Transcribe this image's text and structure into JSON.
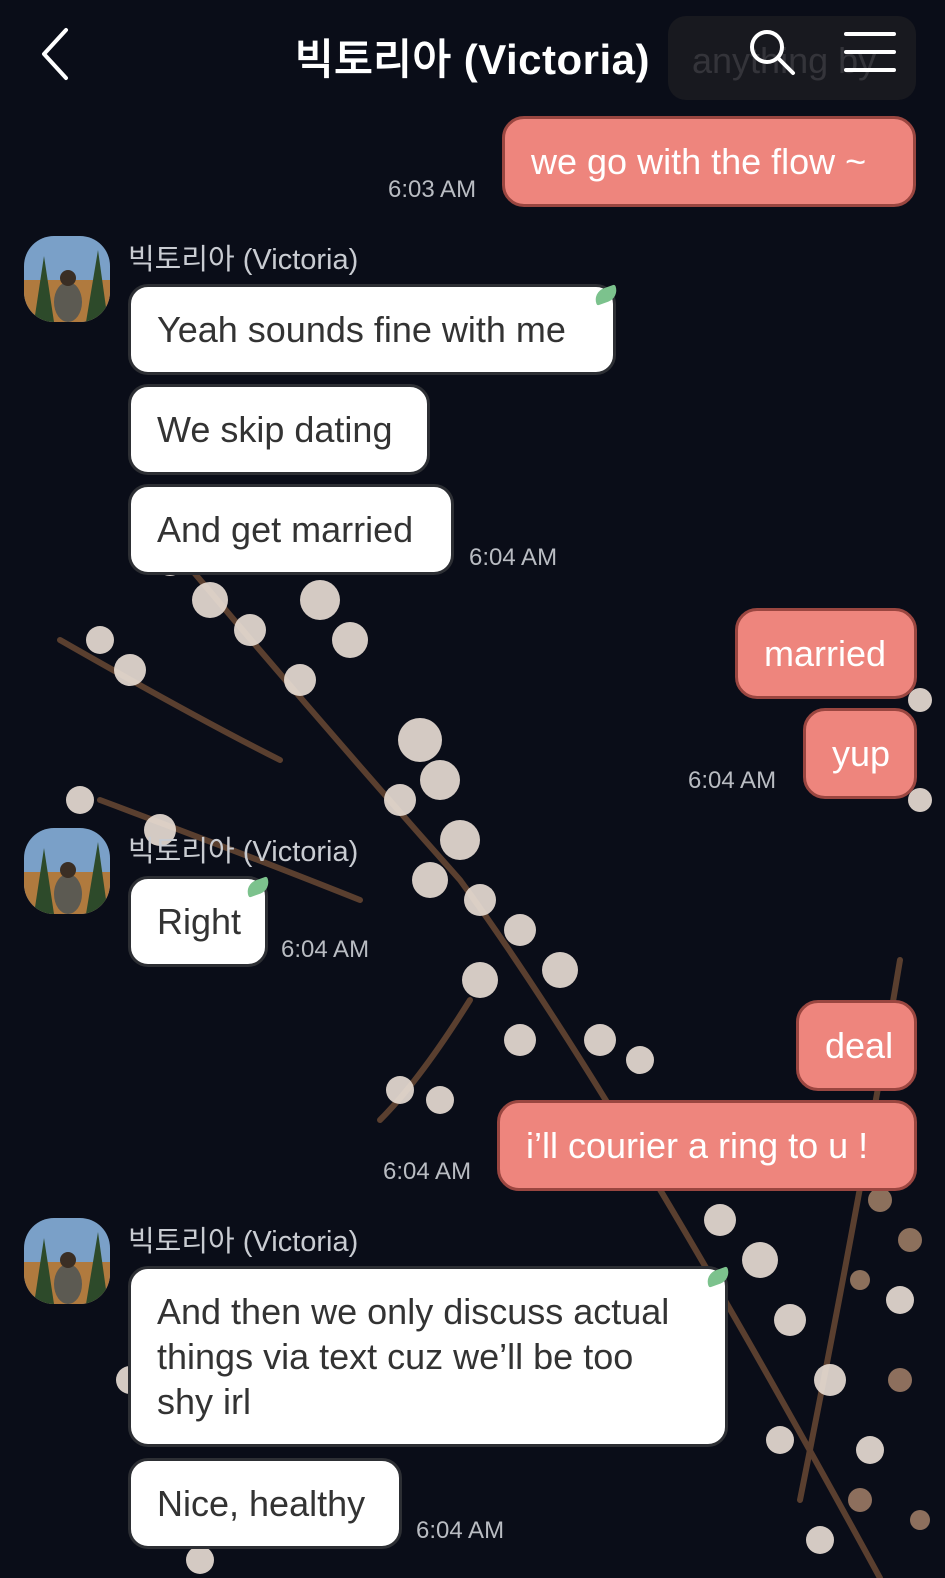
{
  "header": {
    "title": "빅토리아 (Victoria)",
    "search_ghost_text": "anything by"
  },
  "icons": {
    "back": "chevron-left-icon",
    "search": "search-icon",
    "menu": "hamburger-menu-icon"
  },
  "colors": {
    "outgoing_bubble": "#ee857d",
    "incoming_bubble": "#ffffff",
    "background": "#0a0d18",
    "leaf_badge": "#7cc28d"
  },
  "sender_name": "빅토리아 (Victoria)",
  "messages": [
    {
      "dir": "out",
      "text": "we go with the flow ~",
      "time": "6:03 AM"
    },
    {
      "dir": "in",
      "text": "Yeah sounds fine with me"
    },
    {
      "dir": "in",
      "text": "We skip dating"
    },
    {
      "dir": "in",
      "text": "And get married",
      "time": "6:04 AM"
    },
    {
      "dir": "out",
      "text": "married"
    },
    {
      "dir": "out",
      "text": "yup",
      "time": "6:04 AM"
    },
    {
      "dir": "in",
      "text": "Right",
      "time": "6:04 AM"
    },
    {
      "dir": "out",
      "text": "deal"
    },
    {
      "dir": "out",
      "text": "i’ll courier a ring to u !",
      "time": "6:04 AM"
    },
    {
      "dir": "in",
      "text": "And then we only discuss actual things via text cuz we’ll be too shy irl"
    },
    {
      "dir": "in",
      "text": "Nice, healthy",
      "time": "6:04 AM"
    }
  ]
}
